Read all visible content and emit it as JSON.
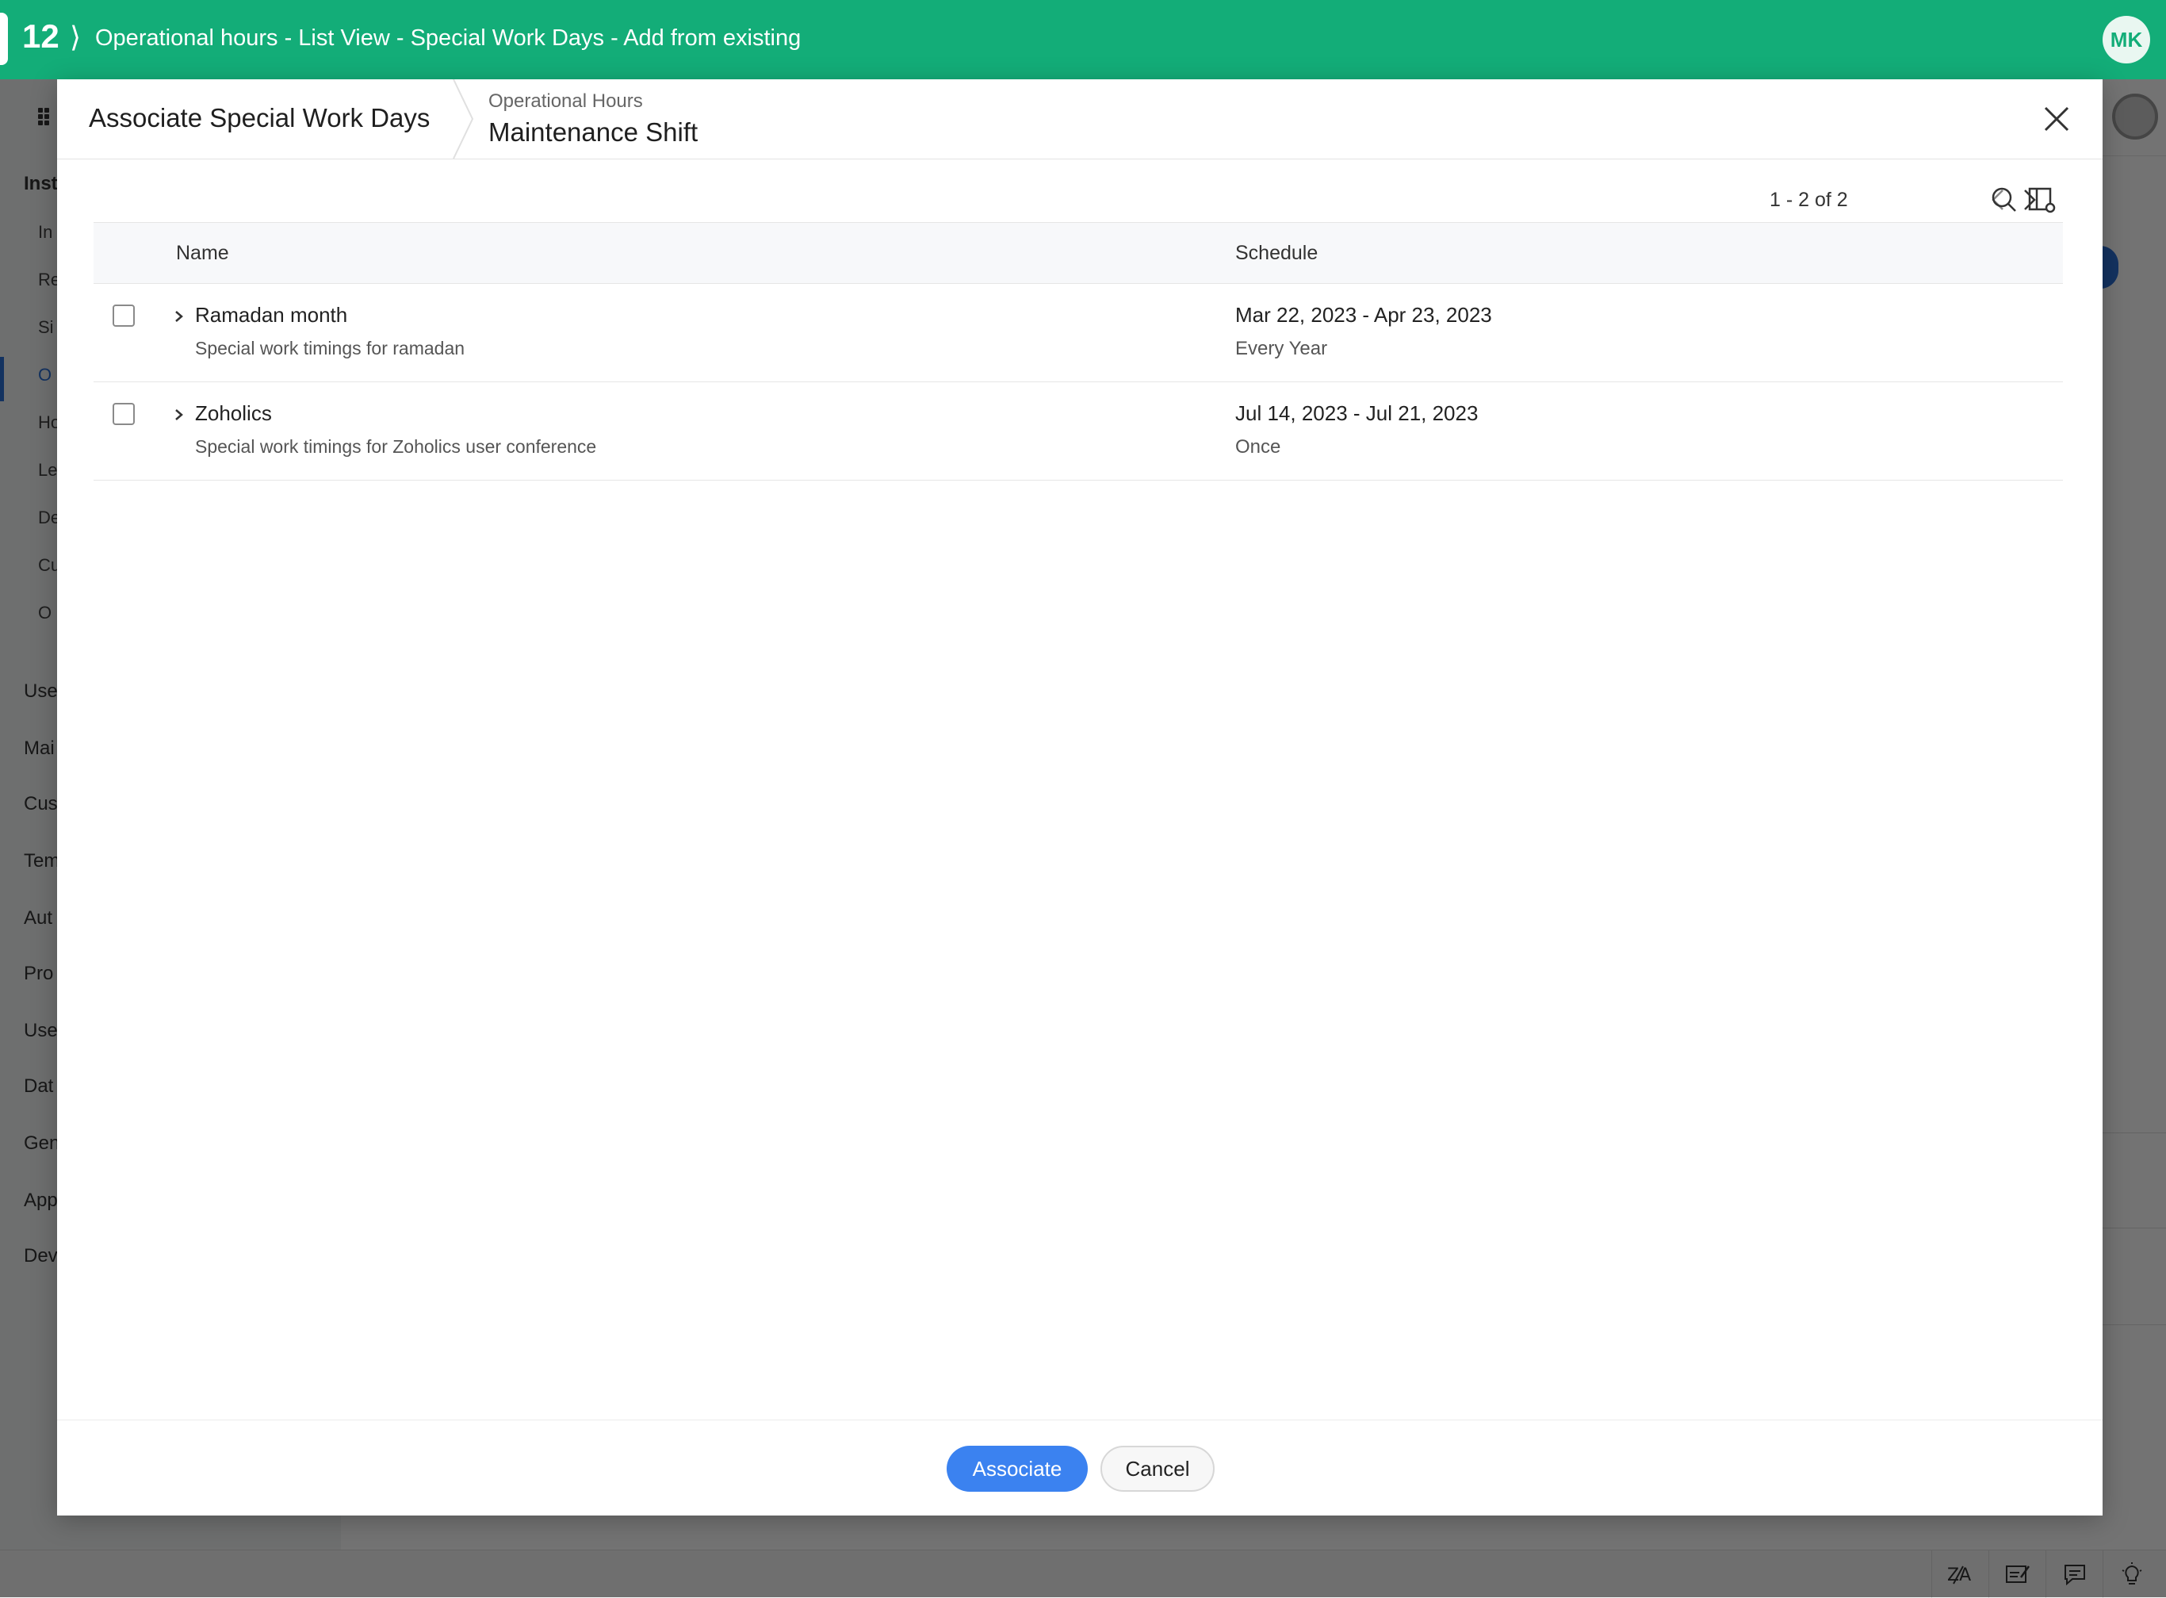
{
  "topbar": {
    "number": "12",
    "separator": "⟩",
    "breadcrumb": "Operational hours - List View - Special Work Days - Add from existing",
    "avatar_initials": "MK",
    "bg_color": "#13ad78"
  },
  "background": {
    "sidebar_items": [
      {
        "label": "Inst",
        "style": "bold"
      },
      {
        "label": "In",
        "style": "sub"
      },
      {
        "label": "Re",
        "style": "sub"
      },
      {
        "label": "Si",
        "style": "sub"
      },
      {
        "label": "O",
        "style": "sub-active"
      },
      {
        "label": "Ho",
        "style": "sub"
      },
      {
        "label": "Le",
        "style": "sub"
      },
      {
        "label": "De",
        "style": "sub"
      },
      {
        "label": "Cu",
        "style": "sub"
      },
      {
        "label": "O",
        "style": "sub"
      },
      {
        "label": "Use",
        "style": "main"
      },
      {
        "label": "Mai",
        "style": "main"
      },
      {
        "label": "Cus",
        "style": "main"
      },
      {
        "label": "Tem",
        "style": "main"
      },
      {
        "label": "Aut",
        "style": "main"
      },
      {
        "label": "Pro",
        "style": "main"
      },
      {
        "label": "Use",
        "style": "main"
      },
      {
        "label": "Dat",
        "style": "main"
      },
      {
        "label": "Gen",
        "style": "main"
      },
      {
        "label": "App",
        "style": "main"
      },
      {
        "label": "Dev",
        "style": "main"
      }
    ],
    "bottom_icons": [
      "translate-icon",
      "notes-icon",
      "chat-icon",
      "bulb-icon"
    ]
  },
  "modal": {
    "title": "Associate Special Work Days",
    "context_label": "Operational Hours",
    "context_title": "Maintenance Shift",
    "pager": "1 - 2 of 2",
    "columns": [
      "Name",
      "Schedule"
    ],
    "rows": [
      {
        "name": "Ramadan month",
        "description": "Special work timings for ramadan",
        "date_range": "Mar 22, 2023 - Apr 23, 2023",
        "frequency": "Every Year"
      },
      {
        "name": "Zoholics",
        "description": "Special work timings for Zoholics user conference",
        "date_range": "Jul 14, 2023 - Jul 21, 2023",
        "frequency": "Once"
      }
    ],
    "buttons": {
      "primary": "Associate",
      "secondary": "Cancel"
    },
    "accent_color": "#3b82f0"
  }
}
